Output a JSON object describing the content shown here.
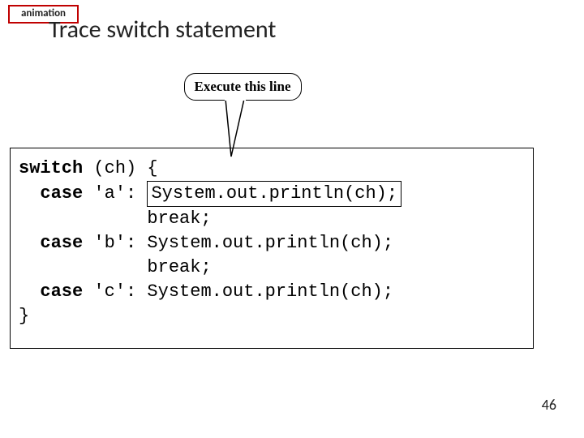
{
  "tag": "animation",
  "title": "Trace switch statement",
  "callout": "Execute this line",
  "code": {
    "kw_switch": "switch",
    "kw_case": "case",
    "switch_expr": " (ch) {",
    "case_a": " 'a': ",
    "hl_stmt": "System.out.println(ch);",
    "break": "            break;",
    "case_b": " 'b': System.out.println(ch);",
    "break2": "            break",
    "semi": ";",
    "case_c": " 'c': System.out.println(ch);",
    "close": "}"
  },
  "pagenum": "46"
}
